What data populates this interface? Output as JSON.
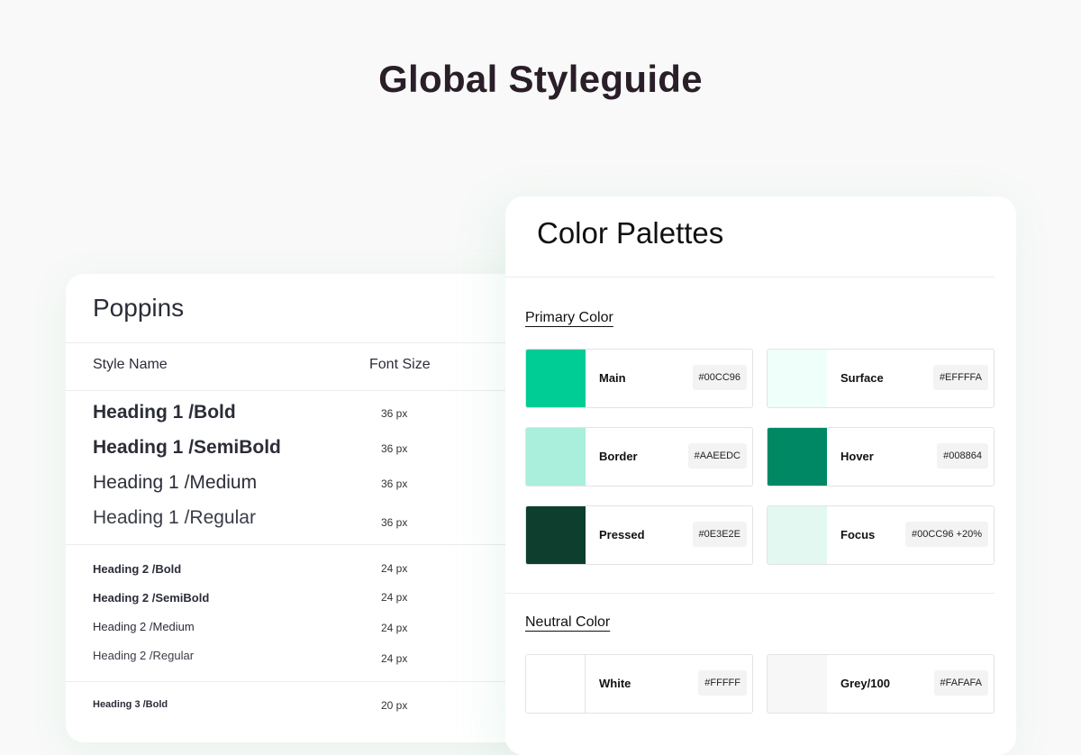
{
  "page": {
    "title": "Global Styleguide"
  },
  "typography": {
    "font_name": "Poppins",
    "columns": {
      "style_name": "Style Name",
      "font_size": "Font Size"
    },
    "rows": [
      {
        "name": "Heading 1 /Bold",
        "size": "36 px"
      },
      {
        "name": "Heading 1 /SemiBold",
        "size": "36 px"
      },
      {
        "name": "Heading 1 /Medium",
        "size": "36 px"
      },
      {
        "name": "Heading 1 /Regular",
        "size": "36 px"
      },
      {
        "name": "Heading 2 /Bold",
        "size": "24 px"
      },
      {
        "name": "Heading 2 /SemiBold",
        "size": "24 px"
      },
      {
        "name": "Heading 2 /Medium",
        "size": "24 px"
      },
      {
        "name": "Heading 2 /Regular",
        "size": "24 px"
      },
      {
        "name": "Heading 3 /Bold",
        "size": "20 px"
      }
    ]
  },
  "colors": {
    "title": "Color Palettes",
    "primary": {
      "label": "Primary Color",
      "swatches": [
        {
          "name": "Main",
          "hex": "#00CC96",
          "color": "#00cc96"
        },
        {
          "name": "Surface",
          "hex": "#EFFFFA",
          "color": "#effffa"
        },
        {
          "name": "Border",
          "hex": "#AAEEDC",
          "color": "#aaeedc"
        },
        {
          "name": "Hover",
          "hex": "#008864",
          "color": "#008864"
        },
        {
          "name": "Pressed",
          "hex": "#0E3E2E",
          "color": "#0e3e2e"
        },
        {
          "name": "Focus",
          "hex": "#00CC96 +20%",
          "color": "#e3f8f1"
        }
      ]
    },
    "neutral": {
      "label": "Neutral Color",
      "swatches": [
        {
          "name": "White",
          "hex": "#FFFFF",
          "color": "#ffffff"
        },
        {
          "name": "Grey/100",
          "hex": "#FAFAFA",
          "color": "#f7f7f7"
        }
      ]
    }
  }
}
